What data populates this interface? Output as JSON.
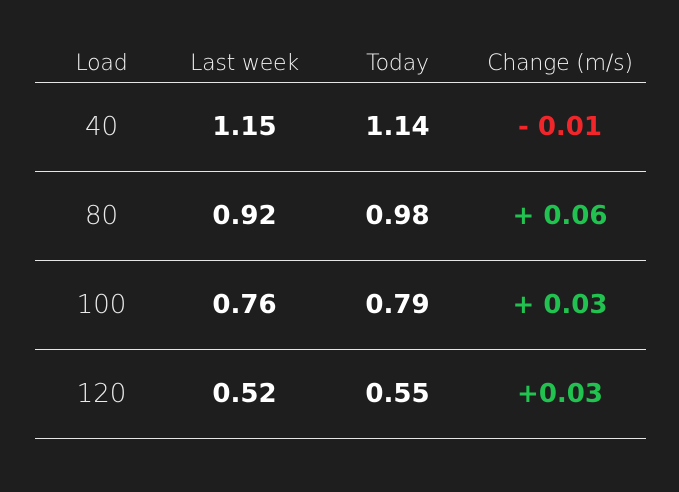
{
  "colors": {
    "background": "#1e1e1f",
    "divider": "#e6e6e6",
    "negative": "#f0262a",
    "positive": "#21c24f"
  },
  "table": {
    "headers": [
      "Load",
      "Last week",
      "Today",
      "Change (m/s)"
    ],
    "rows": [
      {
        "load": "40",
        "last_week": "1.15",
        "today": "1.14",
        "change": "- 0.01",
        "trend": "negative"
      },
      {
        "load": "80",
        "last_week": "0.92",
        "today": "0.98",
        "change": "+ 0.06",
        "trend": "positive"
      },
      {
        "load": "100",
        "last_week": "0.76",
        "today": "0.79",
        "change": "+ 0.03",
        "trend": "positive"
      },
      {
        "load": "120",
        "last_week": "0.52",
        "today": "0.55",
        "change": "+0.03",
        "trend": "positive"
      }
    ]
  }
}
